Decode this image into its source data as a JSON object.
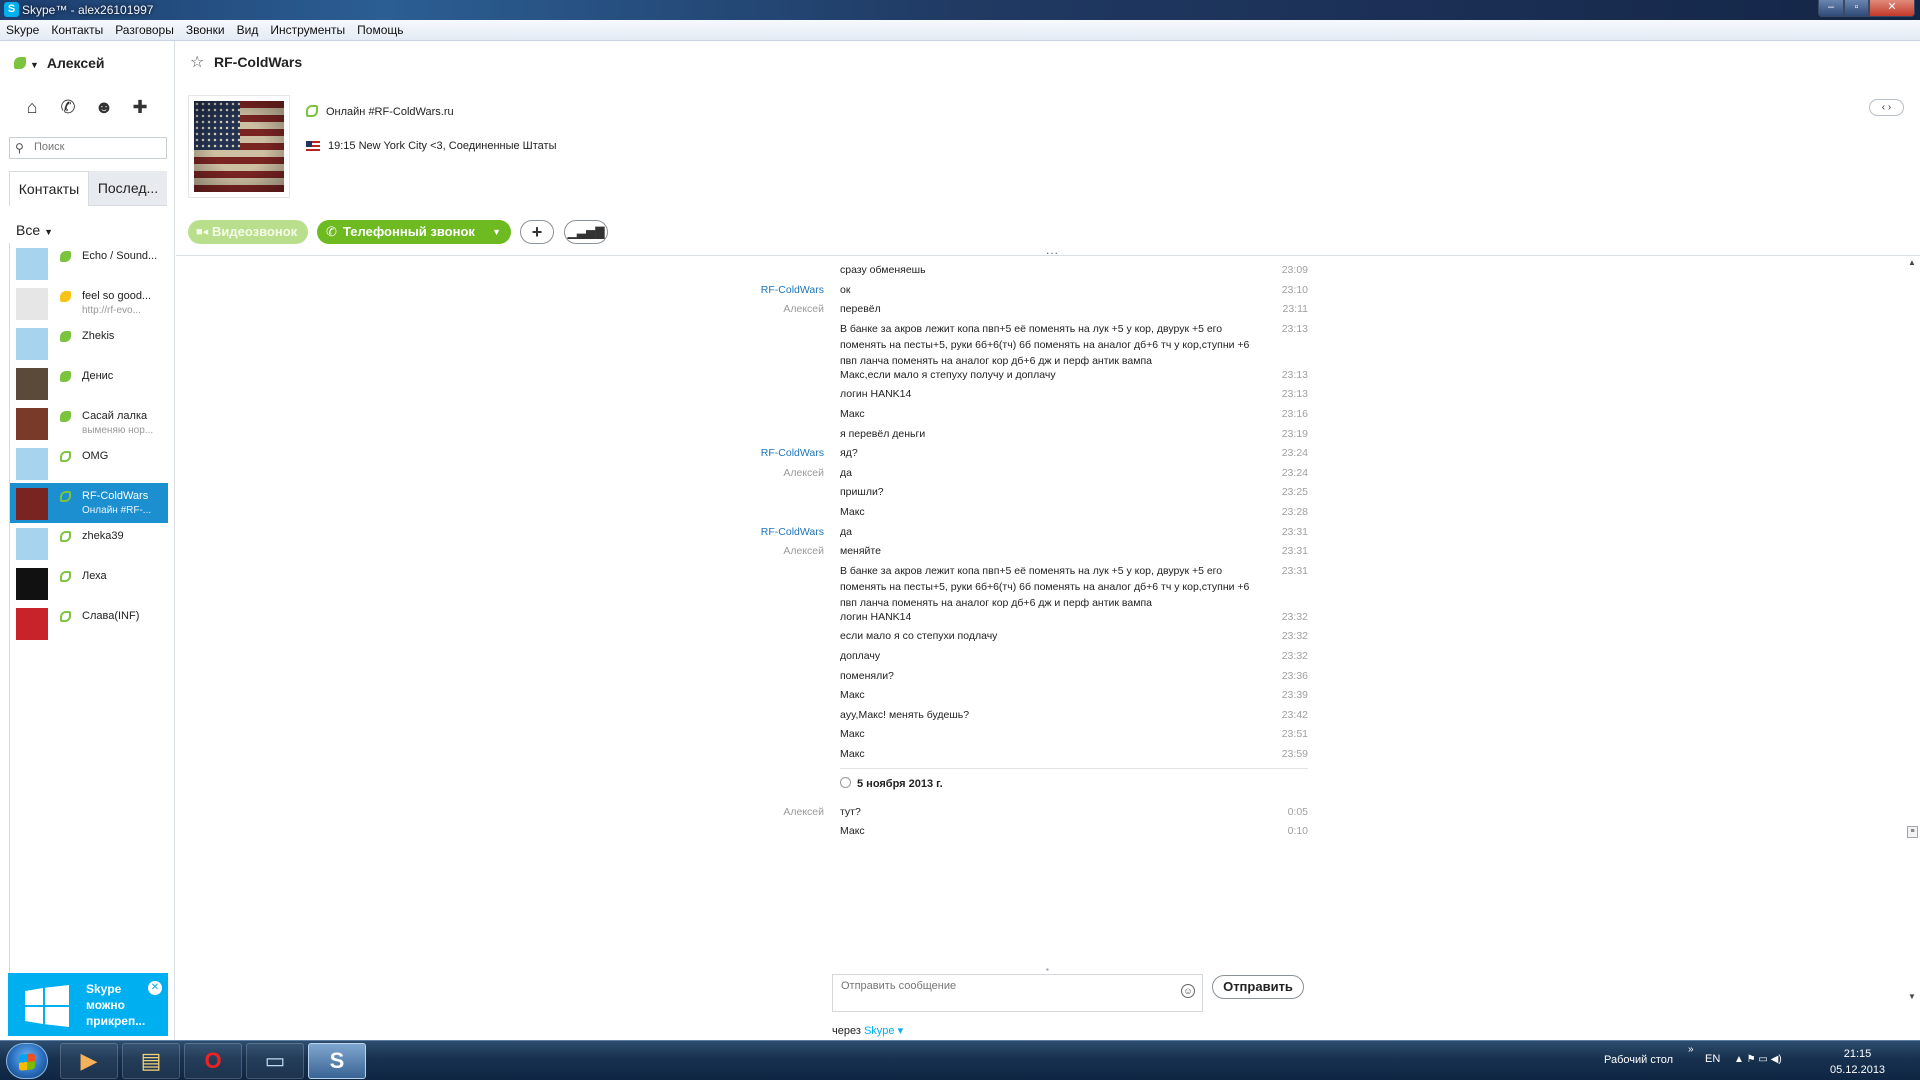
{
  "window": {
    "title": "Skype™ - alex26101997",
    "app_icon": "S",
    "controls": [
      "–",
      "▫",
      "✕"
    ]
  },
  "menu": [
    "Skype",
    "Контакты",
    "Разговоры",
    "Звонки",
    "Вид",
    "Инструменты",
    "Помощь"
  ],
  "sidebar": {
    "user_name": "Алексей",
    "search_placeholder": "Поиск",
    "tabs": [
      "Контакты",
      "Послед..."
    ],
    "filter_label": "Все",
    "contacts": [
      {
        "name": "Echo / Sound...",
        "sub": "",
        "status": "online",
        "avatar_color": "#a8d3ee"
      },
      {
        "name": "feel so good...",
        "sub": "http://rf-evo...",
        "status": "away",
        "avatar_color": "#e6e6e6"
      },
      {
        "name": "Zhekis",
        "sub": "",
        "status": "online",
        "avatar_color": "#a8d3ee"
      },
      {
        "name": "Денис",
        "sub": "",
        "status": "online",
        "avatar_color": "#5b4a3a"
      },
      {
        "name": "Сасай лалка",
        "sub": "выменяю нор...",
        "status": "online",
        "avatar_color": "#7a3a2a"
      },
      {
        "name": "OMG",
        "sub": "",
        "status": "offline",
        "avatar_color": "#a8d3ee"
      },
      {
        "name": "RF-ColdWars",
        "sub": "Онлайн #RF-...",
        "status": "offline",
        "avatar_color": "#7a2422",
        "selected": true
      },
      {
        "name": "zheka39",
        "sub": "",
        "status": "offline",
        "avatar_color": "#a8d3ee"
      },
      {
        "name": "Леха",
        "sub": "",
        "status": "offline",
        "avatar_color": "#111111"
      },
      {
        "name": "Слава(INF)",
        "sub": "",
        "status": "offline",
        "avatar_color": "#c8232a"
      }
    ],
    "ad_text": [
      "Skype",
      "можно",
      "прикреп..."
    ]
  },
  "conversation": {
    "title": "RF-ColdWars",
    "mood": "Онлайн #RF-ColdWars.ru",
    "location": "19:15 New York City <3, Соединенные Штаты",
    "nav_arrows": "‹ ›",
    "buttons": {
      "video": "Видеозвонок",
      "phone": "Телефонный звонок",
      "add": "+",
      "signal": "▁▃▅▇"
    },
    "messages": [
      {
        "author": "",
        "peer": false,
        "text": "сразу обменяешь",
        "time": "23:09"
      },
      {
        "author": "RF-ColdWars",
        "peer": true,
        "text": "ок",
        "time": "23:10"
      },
      {
        "author": "Алексей",
        "peer": false,
        "text": "перевёл",
        "time": "23:11"
      },
      {
        "author": "",
        "peer": false,
        "text": "В банке за акров лежит копа пвп+5 её поменять на лук +5 у кор, двурук +5 его поменять на песты+5, руки 6б+6(тч) 6б поменять на аналог дб+6 тч у кор,ступни +6 пвп ланча поменять на аналог кор дб+6 дж и перф антик вампа",
        "time": "23:13"
      },
      {
        "author": "",
        "peer": false,
        "text": "Макс,если мало я степуху получу и доплачу",
        "time": "23:13"
      },
      {
        "author": "",
        "peer": false,
        "text": "логин HANK14",
        "time": "23:13"
      },
      {
        "author": "",
        "peer": false,
        "text": "Макс",
        "time": "23:16"
      },
      {
        "author": "",
        "peer": false,
        "text": "я перевёл деньги",
        "time": "23:19"
      },
      {
        "author": "RF-ColdWars",
        "peer": true,
        "text": "яд?",
        "time": "23:24"
      },
      {
        "author": "Алексей",
        "peer": false,
        "text": "да",
        "time": "23:24"
      },
      {
        "author": "",
        "peer": false,
        "text": "пришли?",
        "time": "23:25"
      },
      {
        "author": "",
        "peer": false,
        "text": "Макс",
        "time": "23:28"
      },
      {
        "author": "RF-ColdWars",
        "peer": true,
        "text": "да",
        "time": "23:31"
      },
      {
        "author": "Алексей",
        "peer": false,
        "text": "меняйте",
        "time": "23:31"
      },
      {
        "author": "",
        "peer": false,
        "text": "В банке за акров лежит копа пвп+5 её поменять на лук +5 у кор, двурук +5 его поменять на песты+5, руки 6б+6(тч) 6б поменять на аналог дб+6 тч у кор,ступни +6 пвп ланча поменять на аналог кор дб+6 дж и перф антик вампа",
        "time": "23:31"
      },
      {
        "author": "",
        "peer": false,
        "text": "логин HANK14",
        "time": "23:32"
      },
      {
        "author": "",
        "peer": false,
        "text": "если мало я со степухи подлачу",
        "time": "23:32"
      },
      {
        "author": "",
        "peer": false,
        "text": "доплачу",
        "time": "23:32"
      },
      {
        "author": "",
        "peer": false,
        "text": "поменяли?",
        "time": "23:36"
      },
      {
        "author": "",
        "peer": false,
        "text": "Макс",
        "time": "23:39"
      },
      {
        "author": "",
        "peer": false,
        "text": "ayy,Макс! менять будешь?",
        "time": "23:42"
      },
      {
        "author": "",
        "peer": false,
        "text": "Макс",
        "time": "23:51"
      },
      {
        "author": "",
        "peer": false,
        "text": "Макс",
        "time": "23:59"
      }
    ],
    "date_separator": "5 ноября 2013 г.",
    "messages_after": [
      {
        "author": "Алексей",
        "peer": false,
        "text": "тут?",
        "time": "0:05"
      },
      {
        "author": "",
        "peer": false,
        "text": "Макс",
        "time": "0:10"
      }
    ],
    "compose_placeholder": "Отправить сообщение",
    "send_label": "Отправить",
    "via_label": "через",
    "via_service": "Skype ▾"
  },
  "taskbar": {
    "desktop_label": "Рабочий стол",
    "lang": "EN",
    "time": "21:15",
    "date": "05.12.2013"
  }
}
